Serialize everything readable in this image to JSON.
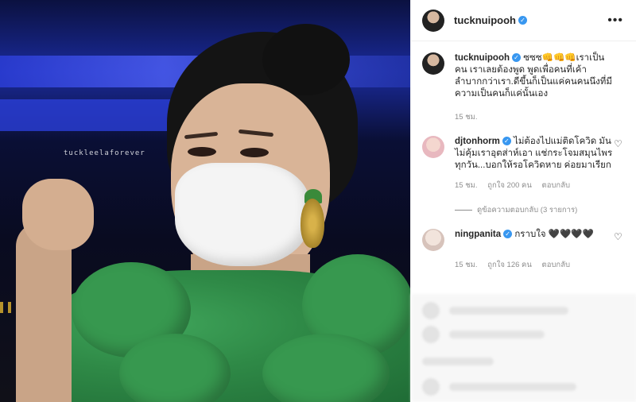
{
  "photo": {
    "watermark": "tuckleelaforever"
  },
  "header": {
    "username": "tucknuipooh",
    "menu_icon": "more-horizontal-icon"
  },
  "caption": {
    "username": "tucknuipooh",
    "text": "ซซซ👊👊👊เราเป็นคน เราเลยต้องพูด พูดเพื่อคนที่เค้าลำบากกว่าเรา.ดีขึ้นก็เป็นแค่คนคนนึงที่มีความเป็นคนก็แค่นั้นเอง",
    "time": "15 ชม."
  },
  "comments": [
    {
      "username": "djtonhorm",
      "text": "ไม่ต้องไปแม่ติดโควิด มันไม่คุ้มเราอุตส่าห์เอา แช่กระโจมสมุนไพรทุกวัน...บอกให้รอโควิดหาย ค่อยมาเรียก",
      "time": "15 ชม.",
      "likes": "ถูกใจ 200 คน",
      "reply": "ตอบกลับ",
      "view_replies": "ดูข้อความตอบกลับ (3 รายการ)"
    },
    {
      "username": "ningpanita",
      "text": "กราบใจ 🖤🖤🖤🖤",
      "time": "15 ชม.",
      "likes": "ถูกใจ 126 คน",
      "reply": "ตอบกลับ"
    }
  ]
}
